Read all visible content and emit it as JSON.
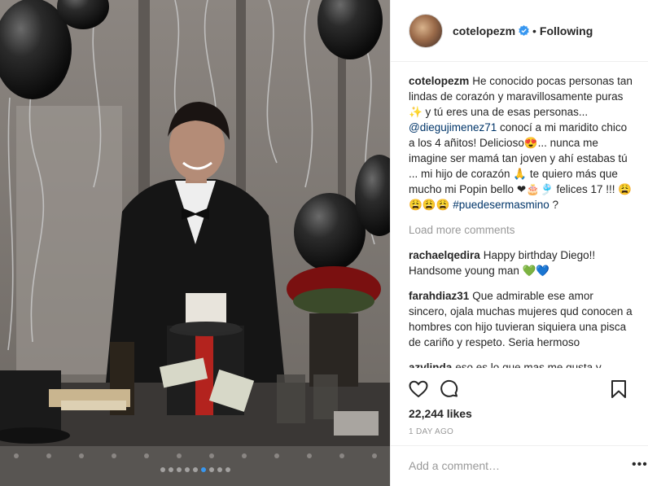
{
  "post": {
    "username": "cotelopezm",
    "follow_status": "Following",
    "separator": "•",
    "caption": {
      "user": "cotelopezm",
      "part1": "He conocido pocas personas tan lindas de corazón y maravillosamente puras ✨ y tú eres una de esas personas... ",
      "mention": "@diegujimenez71",
      "part2": " conocí a mi maridito chico a los 4 añitos! Delicioso😍... nunca me imagine ser mamá tan joven y ahí estabas tú ... mi hijo de corazón 🙏 te quiero más que mucho mi Popin bello ❤🎂🎐 felices 17 !!! 😩😩😩😩 ",
      "hashtag": "#puedesermasmino",
      "part3": " ?"
    },
    "load_more": "Load more comments",
    "comments": [
      {
        "user": "rachaelqedira",
        "text": "Happy birthday Diego!! Handsome young man 💚💙"
      },
      {
        "user": "farahdiaz31",
        "text": "Que admirable ese amor sincero, ojala muchas mujeres qud conocen a hombres con hijo tuvieran siquiera una pisca de cariño y respeto. Seria hermoso"
      },
      {
        "user": "azvlinda",
        "text": "eso es lo que mas me gusta y reitero cero rollos y celos solo amor algunade las envidiosas que haga eso"
      }
    ],
    "likes": "22,244 likes",
    "timestamp": "1 DAY AGO",
    "add_comment_placeholder": "Add a comment…",
    "options_label": "•••"
  },
  "icons": {
    "like": "heart-outline-icon",
    "comment": "speech-bubble-icon",
    "save": "bookmark-icon",
    "verified": "verified-badge-icon"
  },
  "colors": {
    "verified_blue": "#3897f0",
    "link": "#003569",
    "muted": "#999999"
  },
  "carousel": {
    "count": 9,
    "active": 5
  }
}
